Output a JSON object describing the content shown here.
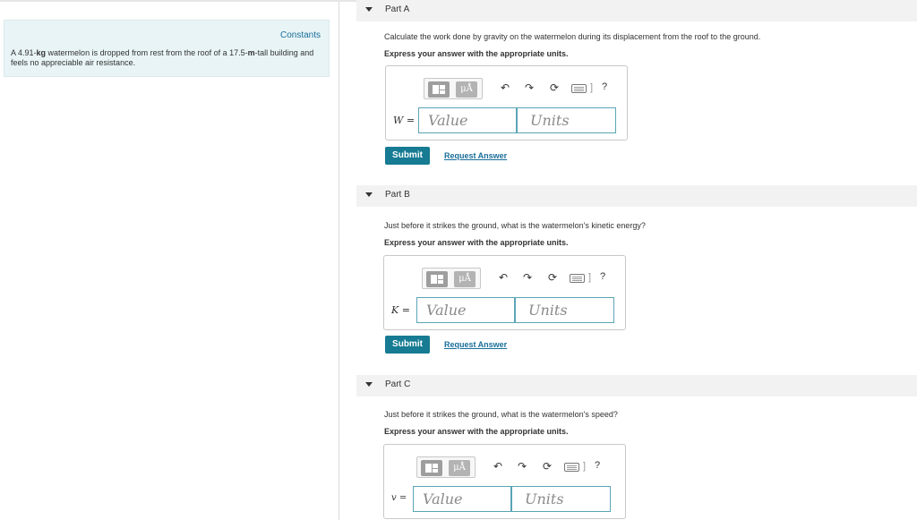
{
  "problem": {
    "constants_label": "Constants",
    "text_pre": "A 4.91-",
    "text_unit1": "kg",
    "text_mid": " watermelon is dropped from rest from the roof of a 17.5-",
    "text_unit2": "m",
    "text_post": "-tall building and feels no appreciable air resistance."
  },
  "toolbar": {
    "units_symbol": "μÅ",
    "undo_symbol": "↶",
    "redo_symbol": "↷",
    "reset_symbol": "⟳",
    "kb_bar": "]",
    "help_symbol": "?"
  },
  "parts": [
    {
      "title": "Part A",
      "question": "Calculate the work done by gravity on the watermelon during its displacement from the roof to the ground.",
      "instruction": "Express your answer with the appropriate units.",
      "variable": "W",
      "equals": "=",
      "value_placeholder": "Value",
      "units_placeholder": "Units",
      "submit_label": "Submit",
      "request_label": "Request Answer"
    },
    {
      "title": "Part B",
      "question": "Just before it strikes the ground, what is the watermelon's kinetic energy?",
      "instruction": "Express your answer with the appropriate units.",
      "variable": "K",
      "equals": "=",
      "value_placeholder": "Value",
      "units_placeholder": "Units",
      "submit_label": "Submit",
      "request_label": "Request Answer"
    },
    {
      "title": "Part C",
      "question": "Just before it strikes the ground, what is the watermelon's speed?",
      "instruction": "Express your answer with the appropriate units.",
      "variable": "v",
      "equals": "=",
      "value_placeholder": "Value",
      "units_placeholder": "Units"
    }
  ],
  "colors": {
    "accent": "#167b93",
    "link": "#1a6e9a",
    "panel_bg": "#e8f4f6"
  },
  "icons": {
    "undo": "undo-icon",
    "redo": "redo-icon",
    "reset": "reset-icon",
    "keyboard": "keyboard-icon",
    "help": "help-icon",
    "templates": "templates-icon",
    "units": "units-icon",
    "caret": "caret-down-icon"
  }
}
